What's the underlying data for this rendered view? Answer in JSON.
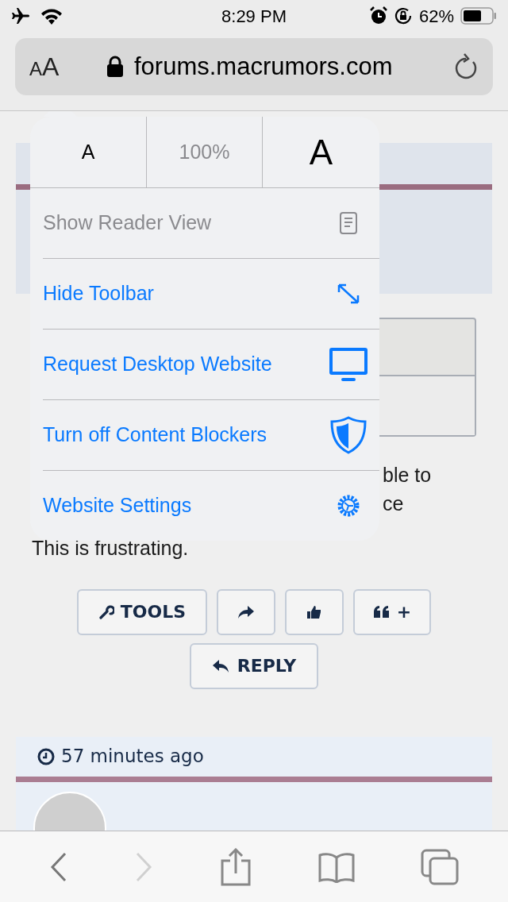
{
  "status_bar": {
    "time": "8:29 PM",
    "battery": "62%"
  },
  "address_bar": {
    "text_size_label": "AA",
    "url": "forums.macrumors.com"
  },
  "text_size": {
    "smaller": "A",
    "zoom": "100%",
    "larger": "A"
  },
  "menu": [
    {
      "kind": "reader",
      "label": "Show Reader View",
      "disabled": true
    },
    {
      "kind": "toolbar",
      "label": "Hide Toolbar",
      "disabled": false
    },
    {
      "kind": "desktop",
      "label": "Request Desktop Website",
      "disabled": false
    },
    {
      "kind": "blockers",
      "label": "Turn off Content Blockers",
      "disabled": false
    },
    {
      "kind": "settings",
      "label": "Website Settings",
      "disabled": false
    }
  ],
  "post": {
    "text_fragments": [
      "ble to",
      "ce"
    ],
    "last_line": "This is frustrating."
  },
  "post_actions": [
    {
      "kind": "tools",
      "label": "TOOLS"
    },
    {
      "kind": "share"
    },
    {
      "kind": "like"
    },
    {
      "kind": "quote",
      "label": "+"
    },
    {
      "kind": "reply",
      "label": "REPLY"
    }
  ],
  "next_post": {
    "time": "57 minutes ago"
  }
}
